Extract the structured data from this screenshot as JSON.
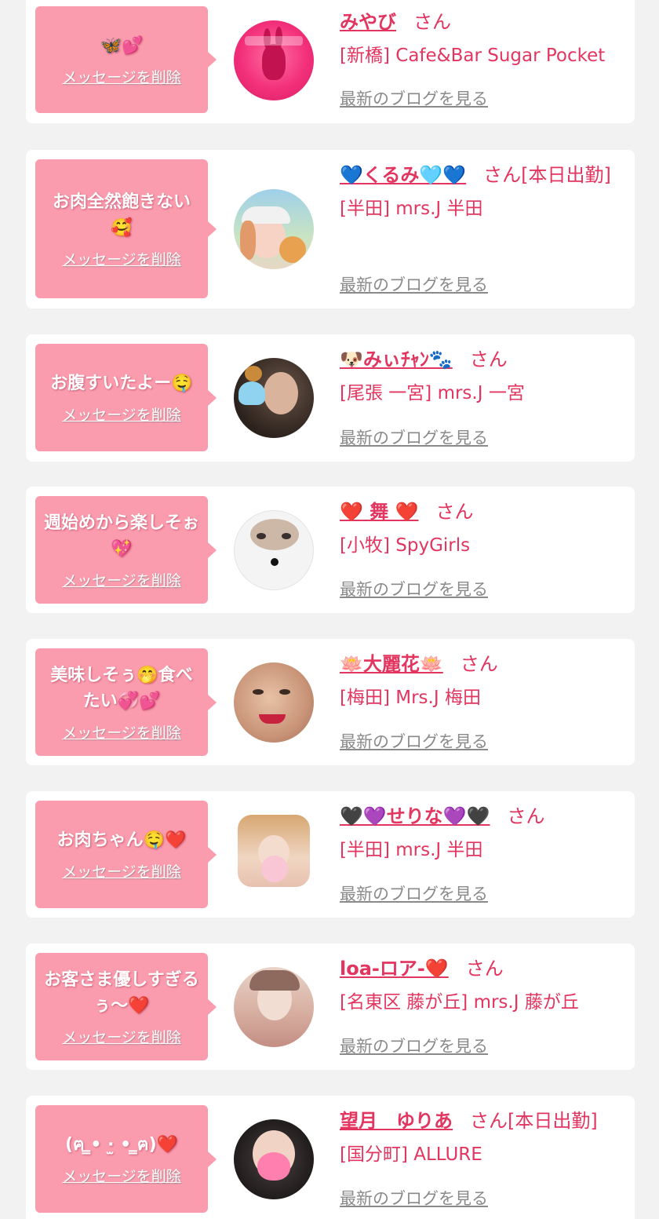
{
  "labels": {
    "delete": "メッセージを削除",
    "blog": "最新のブログを見る",
    "san": "さん"
  },
  "colors": {
    "background": "#f2f2f2",
    "card": "#ffffff",
    "bubble": "#fb9cae",
    "accent": "#e2355f",
    "link_gray": "#8a8a8a"
  },
  "entries": [
    {
      "message": "🦋💕",
      "name": "みやび",
      "status": "",
      "shop": "[新橋] Cafe&Bar Sugar Pocket",
      "avatar_icon": "pink-rabbit-avatar-icon"
    },
    {
      "message": "お肉全然飽きない🥰",
      "name": "💙くるみ🩵💙",
      "status": "[本日出勤]",
      "shop": "[半田] mrs.J 半田",
      "avatar_icon": "woman-with-cap-avatar-icon"
    },
    {
      "message": "お腹すいたよー🤤",
      "name": "🐶みぃﾁｬﾝ🐾",
      "status": "",
      "shop": "[尾張 一宮] mrs.J 一宮",
      "avatar_icon": "woman-with-heart-sticker-avatar-icon"
    },
    {
      "message": "週始めから楽しそぉ💖",
      "name": "❤️ 舞 ❤️",
      "status": "",
      "shop": "[小牧] SpyGirls",
      "avatar_icon": "woman-cat-filter-avatar-icon"
    },
    {
      "message": "美味しそぅ🤭食べたい💞💕",
      "name": "🪷大麗花🪷",
      "status": "",
      "shop": "[梅田] Mrs.J 梅田",
      "avatar_icon": "smiling-woman-avatar-icon"
    },
    {
      "message": "お肉ちゃん🤤❤️",
      "name": "🖤💜せりな💜🖤",
      "status": "",
      "shop": "[半田] mrs.J 半田",
      "avatar_icon": "blonde-woman-avatar-icon"
    },
    {
      "message": "お客さま優しすぎるぅ〜❤️",
      "name": "loa-ロア-❤️",
      "status": "",
      "shop": "[名東区 藤が丘] mrs.J 藤が丘",
      "avatar_icon": "woman-portrait-avatar-icon"
    },
    {
      "message": "(ฅ ̳• ·̫ • ̳ฅ)❤️",
      "name": "望月　ゆりあ",
      "status": "[本日出勤]",
      "shop": "[国分町] ALLURE",
      "avatar_icon": "woman-heart-mask-avatar-icon"
    }
  ]
}
